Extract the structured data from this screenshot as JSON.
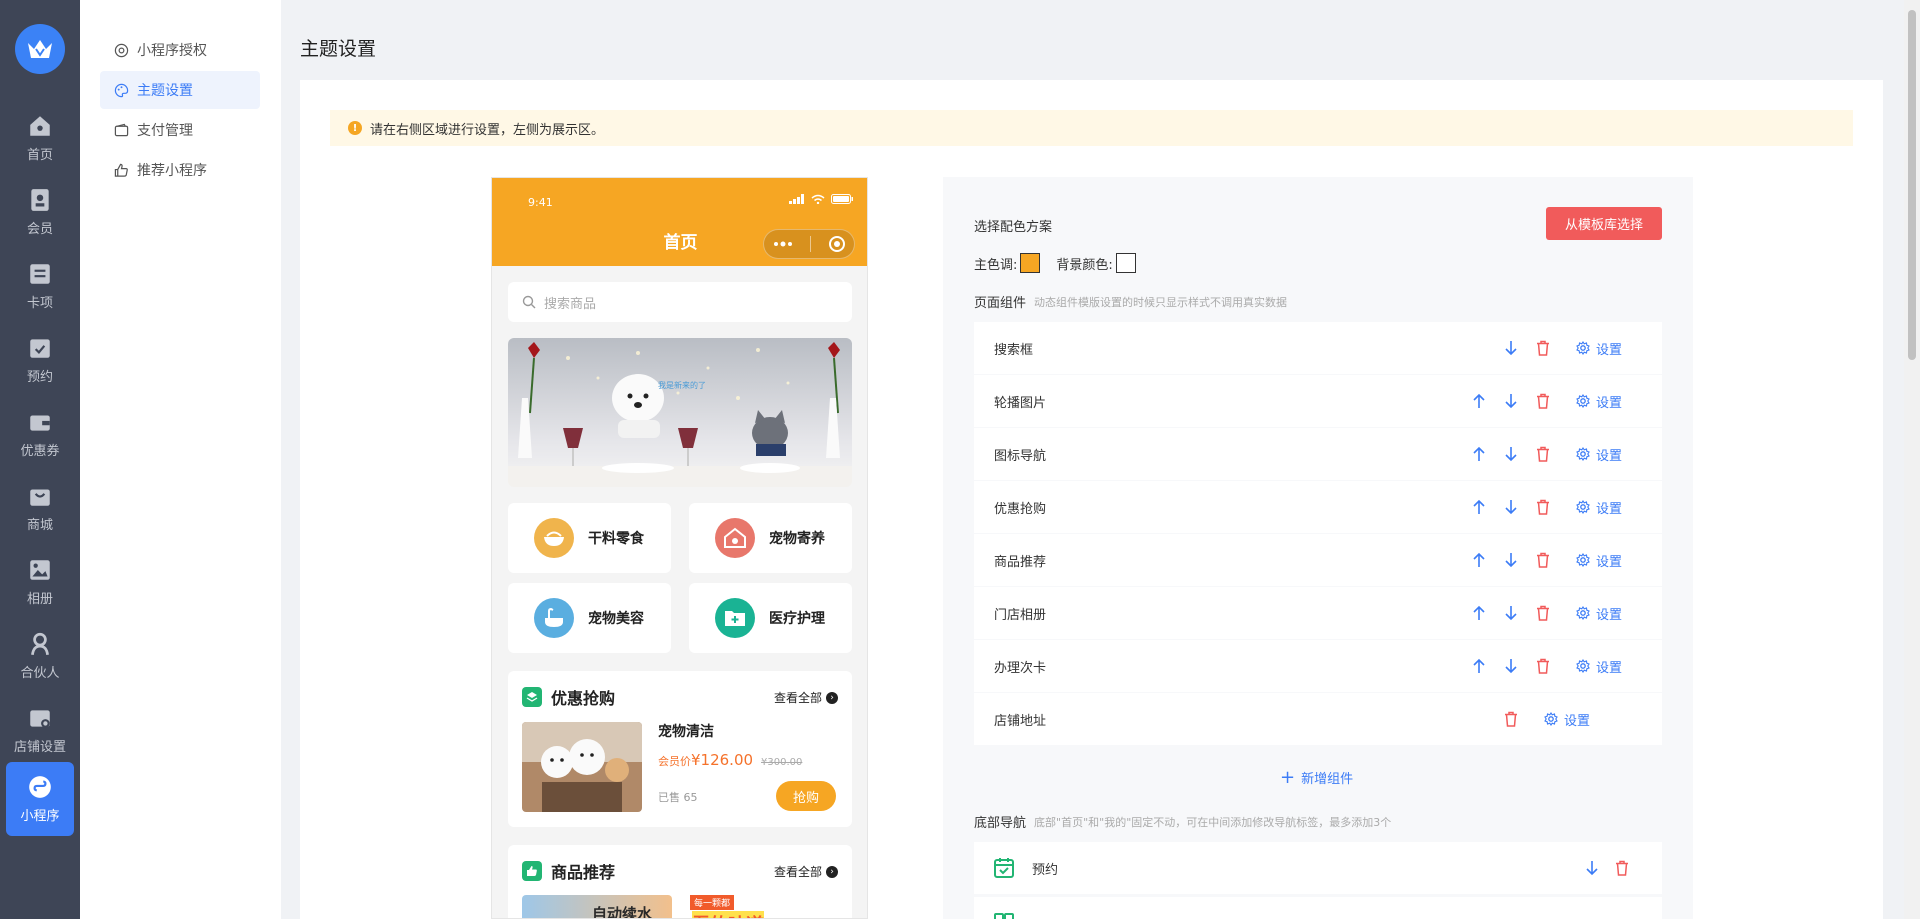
{
  "nav": {
    "items": [
      {
        "label": "首页",
        "icon": "home-icon"
      },
      {
        "label": "会员",
        "icon": "member-icon"
      },
      {
        "label": "卡项",
        "icon": "card-icon"
      },
      {
        "label": "预约",
        "icon": "calendar-icon"
      },
      {
        "label": "优惠券",
        "icon": "wallet-icon"
      },
      {
        "label": "商城",
        "icon": "shop-bag-icon"
      },
      {
        "label": "相册",
        "icon": "album-icon"
      },
      {
        "label": "合伙人",
        "icon": "partner-icon"
      },
      {
        "label": "店铺设置",
        "icon": "store-settings-icon"
      },
      {
        "label": "小程序",
        "icon": "mini-program-icon"
      }
    ]
  },
  "submenu": {
    "items": [
      {
        "label": "小程序授权"
      },
      {
        "label": "主题设置"
      },
      {
        "label": "支付管理"
      },
      {
        "label": "推荐小程序"
      }
    ]
  },
  "page": {
    "title": "主题设置",
    "alert": "请在右侧区域进行设置，左侧为展示区。"
  },
  "phone": {
    "time": "9:41",
    "title": "首页",
    "search_placeholder": "搜索商品",
    "banner_text": "我是新来的了",
    "categories": [
      {
        "label": "干料零食",
        "color": "#f0b44c"
      },
      {
        "label": "宠物寄养",
        "color": "#e8776b"
      },
      {
        "label": "宠物美容",
        "color": "#5aaee0"
      },
      {
        "label": "医疗护理",
        "color": "#1ab394"
      }
    ],
    "flash_sale": {
      "title": "优惠抢购",
      "more": "查看全部",
      "product_name": "宠物清洁",
      "member_price_label": "会员价",
      "member_price": "¥126.00",
      "original_price": "¥300.00",
      "sold": "已售 65",
      "buy_label": "抢购"
    },
    "recommend": {
      "title": "商品推荐",
      "more": "查看全部",
      "card1_text": "自动续水",
      "card2_badge": "每一颗都",
      "card2_text": "吾的味道"
    }
  },
  "panel": {
    "color_scheme_label": "选择配色方案",
    "template_button": "从模板库选择",
    "main_color_label": "主色调:",
    "main_color": "#f6a623",
    "bg_color_label": "背景颜色:",
    "bg_color": "#ffffff",
    "components_label": "页面组件",
    "components_hint": "动态组件模版设置的时候只显示样式不调用真实数据",
    "components": [
      {
        "name": "搜索框",
        "up": false,
        "down": true,
        "setting": "设置"
      },
      {
        "name": "轮播图片",
        "up": true,
        "down": true,
        "setting": "设置"
      },
      {
        "name": "图标导航",
        "up": true,
        "down": true,
        "setting": "设置"
      },
      {
        "name": "优惠抢购",
        "up": true,
        "down": true,
        "setting": "设置"
      },
      {
        "name": "商品推荐",
        "up": true,
        "down": true,
        "setting": "设置"
      },
      {
        "name": "门店相册",
        "up": true,
        "down": true,
        "setting": "设置"
      },
      {
        "name": "办理次卡",
        "up": true,
        "down": true,
        "setting": "设置"
      },
      {
        "name": "店铺地址",
        "up": true,
        "down": false,
        "setting": "设置"
      }
    ],
    "add_component": "新增组件",
    "bottom_nav_label": "底部导航",
    "bottom_nav_hint": "底部\"首页\"和\"我的\"固定不动，可在中间添加修改导航标签，最多添加3个",
    "bottom_nav_items": [
      {
        "name": "预约"
      }
    ]
  }
}
